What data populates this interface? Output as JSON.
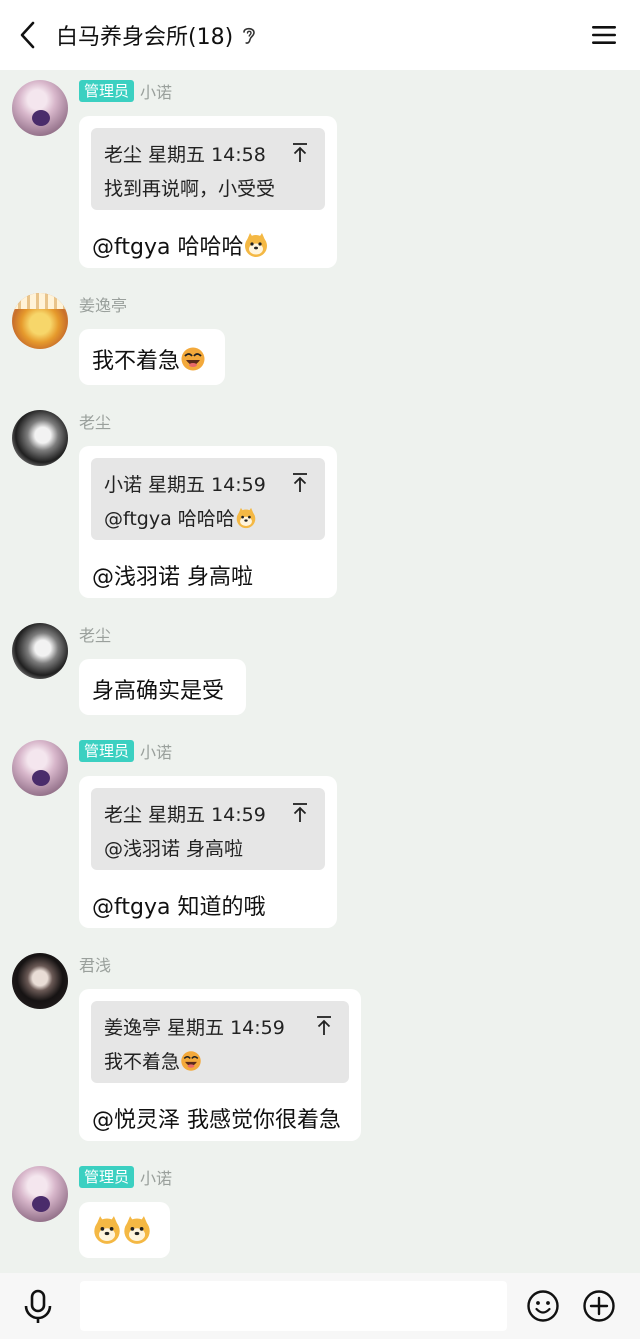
{
  "header": {
    "title": "白马养身会所(18)"
  },
  "messages": [
    {
      "admin_badge": "管理员",
      "sender": "小诺",
      "quote": {
        "head": "老尘 星期五 14:58",
        "text": "找到再说啊，小受受"
      },
      "text": "@ftgya 哈哈哈",
      "text_emoji": "doge-emoji"
    },
    {
      "sender": "姜逸亭",
      "text": "我不着急",
      "text_emoji": "laugh-emoji"
    },
    {
      "sender": "老尘",
      "quote": {
        "head": "小诺 星期五 14:59",
        "text": "@ftgya 哈哈哈"
      },
      "text": "@浅羽诺 身高啦"
    },
    {
      "sender": "老尘",
      "text": "身高确实是受"
    },
    {
      "admin_badge": "管理员",
      "sender": "小诺",
      "quote": {
        "head": "老尘 星期五 14:59",
        "text": "@浅羽诺 身高啦"
      },
      "text": "@ftgya 知道的哦"
    },
    {
      "sender": "君浅",
      "quote": {
        "head": "姜逸亭 星期五 14:59",
        "text": "我不着急"
      },
      "text": "@悦灵泽 我感觉你很着急"
    },
    {
      "admin_badge": "管理员",
      "sender": "小诺",
      "text": "",
      "text_emoji": "doge-emoji x2"
    }
  ],
  "composer": {
    "value": "",
    "placeholder": ""
  }
}
